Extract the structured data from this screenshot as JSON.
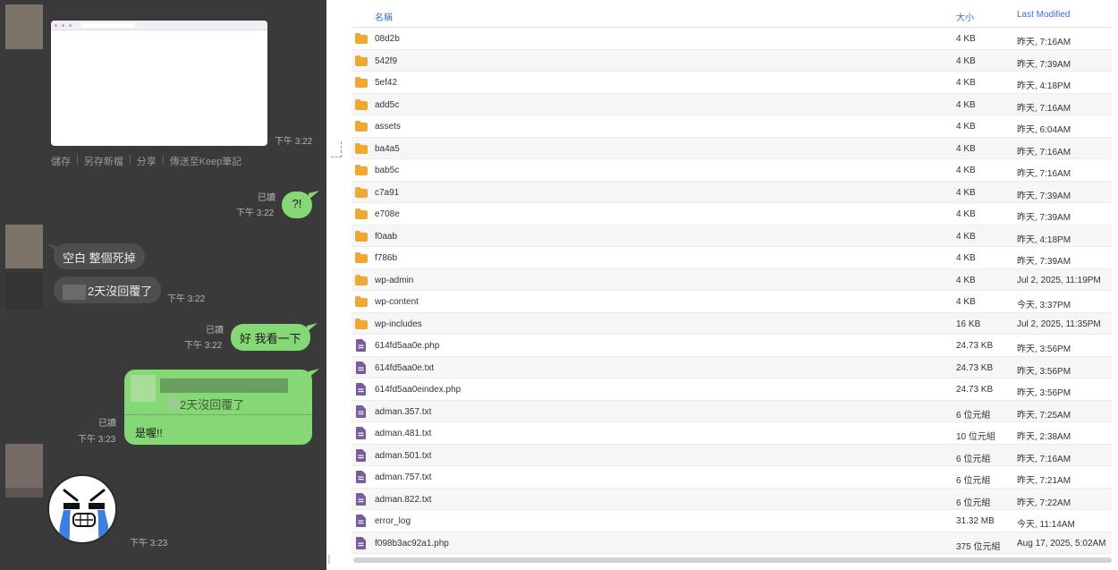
{
  "chat": {
    "image_time": "下午 3:22",
    "image_actions": [
      "儲存",
      "另存新檔",
      "分享",
      "傳送至Keep筆記"
    ],
    "msg1": {
      "read": "已讀",
      "time": "下午 3:22",
      "text": "?!"
    },
    "msg2": {
      "text": "空白  整個死掉"
    },
    "msg3": {
      "text": "2天沒回覆了",
      "time": "下午 3:22"
    },
    "msg4": {
      "read": "已讀",
      "time": "下午 3:22",
      "text": "好 我看一下"
    },
    "msg5": {
      "read": "已讀",
      "time": "下午 3:23",
      "quote": "2天沒回覆了",
      "text": "是喔!!"
    },
    "sticker_time": "下午 3:23",
    "colors": {
      "background": "#3a3a3a",
      "green_bubble": "#85d875",
      "grey_bubble": "#4e4e4e"
    }
  },
  "file_table": {
    "headers": {
      "name": "名稱",
      "size": "大小",
      "modified": "Last Modified"
    },
    "rows": [
      {
        "type": "folder",
        "name": "08d2b",
        "size": "4 KB",
        "modified": "昨天, 7:16AM"
      },
      {
        "type": "folder",
        "name": "542f9",
        "size": "4 KB",
        "modified": "昨天, 7:39AM"
      },
      {
        "type": "folder",
        "name": "5ef42",
        "size": "4 KB",
        "modified": "昨天, 4:18PM"
      },
      {
        "type": "folder",
        "name": "add5c",
        "size": "4 KB",
        "modified": "昨天, 7:16AM"
      },
      {
        "type": "folder",
        "name": "assets",
        "size": "4 KB",
        "modified": "昨天, 6:04AM"
      },
      {
        "type": "folder",
        "name": "ba4a5",
        "size": "4 KB",
        "modified": "昨天, 7:16AM"
      },
      {
        "type": "folder",
        "name": "bab5c",
        "size": "4 KB",
        "modified": "昨天, 7:16AM"
      },
      {
        "type": "folder",
        "name": "c7a91",
        "size": "4 KB",
        "modified": "昨天, 7:39AM"
      },
      {
        "type": "folder",
        "name": "e708e",
        "size": "4 KB",
        "modified": "昨天, 7:39AM"
      },
      {
        "type": "folder",
        "name": "f0aab",
        "size": "4 KB",
        "modified": "昨天, 4:18PM"
      },
      {
        "type": "folder",
        "name": "f786b",
        "size": "4 KB",
        "modified": "昨天, 7:39AM"
      },
      {
        "type": "folder",
        "name": "wp-admin",
        "size": "4 KB",
        "modified": "Jul 2, 2025, 11:19PM"
      },
      {
        "type": "folder",
        "name": "wp-content",
        "size": "4 KB",
        "modified": "今天, 3:37PM"
      },
      {
        "type": "folder",
        "name": "wp-includes",
        "size": "16 KB",
        "modified": "Jul 2, 2025, 11:35PM"
      },
      {
        "type": "file",
        "name": "614fd5aa0e.php",
        "size": "24.73 KB",
        "modified": "昨天, 3:56PM"
      },
      {
        "type": "file",
        "name": "614fd5aa0e.txt",
        "size": "24.73 KB",
        "modified": "昨天, 3:56PM"
      },
      {
        "type": "file",
        "name": "614fd5aa0eindex.php",
        "size": "24.73 KB",
        "modified": "昨天, 3:56PM"
      },
      {
        "type": "file",
        "name": "adman.357.txt",
        "size": "6 位元組",
        "modified": "昨天, 7:25AM"
      },
      {
        "type": "file",
        "name": "adman.481.txt",
        "size": "10 位元組",
        "modified": "昨天, 2:38AM"
      },
      {
        "type": "file",
        "name": "adman.501.txt",
        "size": "6 位元組",
        "modified": "昨天, 7:16AM"
      },
      {
        "type": "file",
        "name": "adman.757.txt",
        "size": "6 位元組",
        "modified": "昨天, 7:21AM"
      },
      {
        "type": "file",
        "name": "adman.822.txt",
        "size": "6 位元組",
        "modified": "昨天, 7:22AM"
      },
      {
        "type": "file",
        "name": "error_log",
        "size": "31.32 MB",
        "modified": "今天, 11:14AM"
      },
      {
        "type": "file",
        "name": "f098b3ac92a1.php",
        "size": "375 位元組",
        "modified": "Aug 17, 2025, 5:02AM"
      }
    ],
    "colors": {
      "header_text": "#3b6bd6",
      "folder": "#f0a830",
      "file": "#7a5c9e"
    }
  }
}
